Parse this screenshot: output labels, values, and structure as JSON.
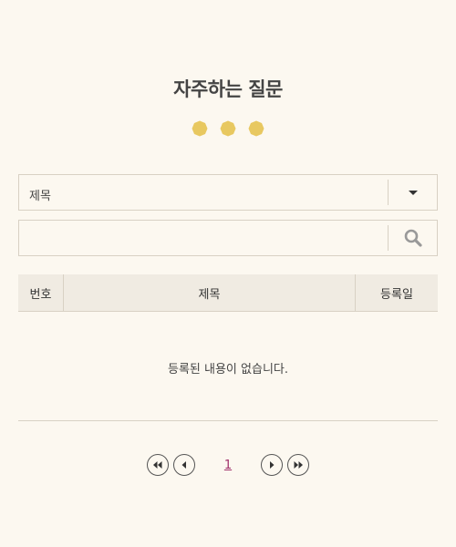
{
  "header": {
    "title": "자주하는 질문",
    "dots_color": "#e8c860"
  },
  "search": {
    "field_select": {
      "selected": "제목",
      "icon": "caret-down-icon"
    },
    "keyword_input": {
      "value": "",
      "placeholder": ""
    },
    "button_icon": "search-icon"
  },
  "table": {
    "columns": [
      "번호",
      "제목",
      "등록일"
    ],
    "rows": [],
    "empty_message": "등록된 내용이 없습니다."
  },
  "pagination": {
    "current_page": "1",
    "first_icon": "double-chevron-left-icon",
    "prev_icon": "chevron-left-icon",
    "next_icon": "chevron-right-icon",
    "last_icon": "double-chevron-right-icon"
  },
  "colors": {
    "background": "#fcf8f0",
    "border": "#d8d1c4",
    "header_bg": "#f0ebe2",
    "accent": "#e8c860",
    "page_link": "#a0306a"
  }
}
